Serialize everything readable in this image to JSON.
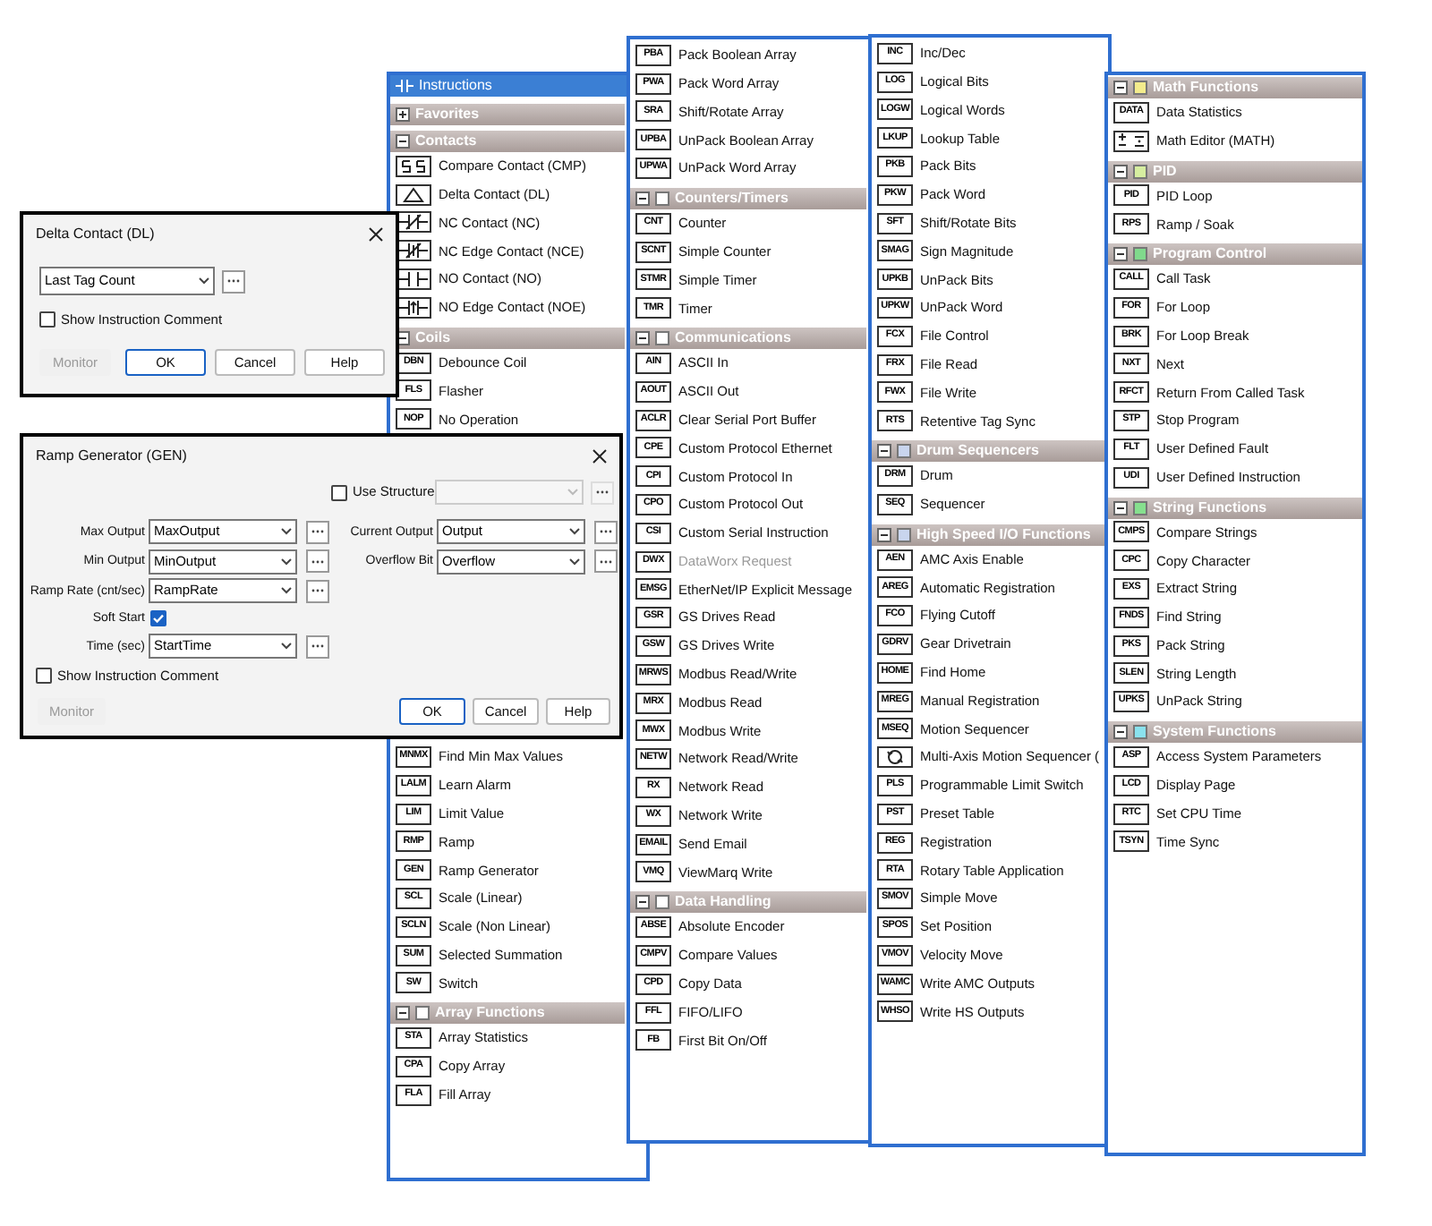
{
  "panels": [
    {
      "title": "Instructions",
      "sections": [
        {
          "header": "Favorites",
          "expanded": false
        },
        {
          "header": "Contacts",
          "expanded": true,
          "items": [
            {
              "kind": "compare",
              "label": "Compare Contact  (CMP)"
            },
            {
              "kind": "delta",
              "label": "Delta Contact  (DL)"
            },
            {
              "kind": "nc",
              "label": "NC Contact  (NC)"
            },
            {
              "kind": "nce",
              "label": "NC Edge Contact  (NCE)"
            },
            {
              "kind": "no",
              "label": "NO Contact  (NO)"
            },
            {
              "kind": "noe",
              "label": "NO Edge Contact  (NOE)"
            }
          ]
        },
        {
          "header": "Coils",
          "expanded": true,
          "items": [
            {
              "kind": "code",
              "code": "DBN",
              "label": "Debounce Coil"
            },
            {
              "kind": "code",
              "code": "FLS",
              "label": "Flasher"
            },
            {
              "kind": "code",
              "code": "NOP",
              "label": "No Operation"
            }
          ]
        },
        {
          "items": [
            {
              "kind": "code",
              "code": "MNMX",
              "label": "Find Min Max Values"
            },
            {
              "kind": "code",
              "code": "LALM",
              "label": "Learn Alarm"
            },
            {
              "kind": "code",
              "code": "LIM",
              "label": "Limit Value"
            },
            {
              "kind": "code",
              "code": "RMP",
              "label": "Ramp"
            },
            {
              "kind": "code",
              "code": "GEN",
              "label": "Ramp Generator"
            },
            {
              "kind": "code",
              "code": "SCL",
              "label": "Scale (Linear)"
            },
            {
              "kind": "code",
              "code": "SCLN",
              "label": "Scale (Non Linear)"
            },
            {
              "kind": "code",
              "code": "SUM",
              "label": "Selected Summation"
            },
            {
              "kind": "code",
              "code": "SW",
              "label": "Switch"
            }
          ]
        },
        {
          "header": "Array Functions",
          "expanded": true,
          "color": "#ffffff",
          "items": [
            {
              "kind": "code",
              "code": "STA",
              "label": "Array Statistics"
            },
            {
              "kind": "code",
              "code": "CPA",
              "label": "Copy Array"
            },
            {
              "kind": "code",
              "code": "FLA",
              "label": "Fill Array"
            }
          ]
        }
      ]
    },
    {
      "sections": [
        {
          "items": [
            {
              "kind": "code",
              "code": "PBA",
              "label": "Pack Boolean Array"
            },
            {
              "kind": "code",
              "code": "PWA",
              "label": "Pack Word Array"
            },
            {
              "kind": "code",
              "code": "SRA",
              "label": "Shift/Rotate Array"
            },
            {
              "kind": "code",
              "code": "UPBA",
              "label": "UnPack Boolean Array"
            },
            {
              "kind": "code",
              "code": "UPWA",
              "label": "UnPack Word Array"
            }
          ]
        },
        {
          "header": "Counters/Timers",
          "expanded": true,
          "color": "#ffffff",
          "items": [
            {
              "kind": "code",
              "code": "CNT",
              "label": "Counter"
            },
            {
              "kind": "code",
              "code": "SCNT",
              "label": "Simple Counter"
            },
            {
              "kind": "code",
              "code": "STMR",
              "label": "Simple Timer"
            },
            {
              "kind": "code",
              "code": "TMR",
              "label": "Timer"
            }
          ]
        },
        {
          "header": "Communications",
          "expanded": true,
          "color": "#ffffff",
          "items": [
            {
              "kind": "code",
              "code": "AIN",
              "label": "ASCII In",
              "disabled": false
            },
            {
              "kind": "code",
              "code": "AOUT",
              "label": "ASCII Out",
              "disabled": false
            },
            {
              "kind": "code",
              "code": "ACLR",
              "label": "Clear Serial Port Buffer",
              "disabled": false
            },
            {
              "kind": "code",
              "code": "CPE",
              "label": "Custom Protocol Ethernet",
              "disabled": false
            },
            {
              "kind": "code",
              "code": "CPI",
              "label": "Custom Protocol In",
              "disabled": false
            },
            {
              "kind": "code",
              "code": "CPO",
              "label": "Custom Protocol Out",
              "disabled": false
            },
            {
              "kind": "code",
              "code": "CSI",
              "label": "Custom Serial Instruction",
              "disabled": false
            },
            {
              "kind": "code",
              "code": "DWX",
              "label": "DataWorx Request",
              "disabled": true
            },
            {
              "kind": "code",
              "code": "EMSG",
              "label": "EtherNet/IP Explicit Message",
              "disabled": false
            },
            {
              "kind": "code",
              "code": "GSR",
              "label": "GS Drives Read",
              "disabled": false
            },
            {
              "kind": "code",
              "code": "GSW",
              "label": "GS Drives Write",
              "disabled": false
            },
            {
              "kind": "code",
              "code": "MRWS",
              "label": "Modbus Read/Write",
              "disabled": false
            },
            {
              "kind": "code",
              "code": "MRX",
              "label": "Modbus Read",
              "disabled": false
            },
            {
              "kind": "code",
              "code": "MWX",
              "label": "Modbus Write",
              "disabled": false
            },
            {
              "kind": "code",
              "code": "NETW",
              "label": "Network Read/Write",
              "disabled": false
            },
            {
              "kind": "code",
              "code": "RX",
              "label": "Network Read",
              "disabled": false
            },
            {
              "kind": "code",
              "code": "WX",
              "label": "Network Write",
              "disabled": false
            },
            {
              "kind": "code",
              "code": "EMAIL",
              "label": "Send Email",
              "disabled": false
            },
            {
              "kind": "code",
              "code": "VMQ",
              "label": "ViewMarq Write",
              "disabled": false
            }
          ]
        },
        {
          "header": "Data Handling",
          "expanded": true,
          "color": "#ffffff",
          "items": [
            {
              "kind": "code",
              "code": "ABSE",
              "label": "Absolute Encoder"
            },
            {
              "kind": "code",
              "code": "CMPV",
              "label": "Compare Values"
            },
            {
              "kind": "code",
              "code": "CPD",
              "label": "Copy Data"
            },
            {
              "kind": "code",
              "code": "FFL",
              "label": "FIFO/LIFO"
            },
            {
              "kind": "code",
              "code": "FB",
              "label": "First Bit On/Off"
            }
          ]
        }
      ]
    },
    {
      "sections": [
        {
          "items": [
            {
              "kind": "code",
              "code": "INC",
              "label": "Inc/Dec"
            },
            {
              "kind": "code",
              "code": "LOG",
              "label": "Logical Bits"
            },
            {
              "kind": "code",
              "code": "LOGW",
              "label": "Logical Words"
            },
            {
              "kind": "code",
              "code": "LKUP",
              "label": "Lookup Table"
            },
            {
              "kind": "code",
              "code": "PKB",
              "label": "Pack Bits"
            },
            {
              "kind": "code",
              "code": "PKW",
              "label": "Pack Word"
            },
            {
              "kind": "code",
              "code": "SFT",
              "label": "Shift/Rotate Bits"
            },
            {
              "kind": "code",
              "code": "SMAG",
              "label": "Sign Magnitude"
            },
            {
              "kind": "code",
              "code": "UPKB",
              "label": "UnPack Bits"
            },
            {
              "kind": "code",
              "code": "UPKW",
              "label": "UnPack Word"
            },
            {
              "kind": "code",
              "code": "FCX",
              "label": "File Control"
            },
            {
              "kind": "code",
              "code": "FRX",
              "label": "File Read"
            },
            {
              "kind": "code",
              "code": "FWX",
              "label": "File Write"
            },
            {
              "kind": "code",
              "code": "RTS",
              "label": "Retentive Tag Sync"
            }
          ]
        },
        {
          "header": "Drum Sequencers",
          "expanded": true,
          "color": "#c9d5ee",
          "items": [
            {
              "kind": "code",
              "code": "DRM",
              "label": "Drum"
            },
            {
              "kind": "code",
              "code": "SEQ",
              "label": "Sequencer"
            }
          ]
        },
        {
          "header": "High Speed I/O Functions",
          "expanded": true,
          "color": "#c9d5ee",
          "items": [
            {
              "kind": "code",
              "code": "AEN",
              "label": "AMC Axis Enable"
            },
            {
              "kind": "code",
              "code": "AREG",
              "label": "Automatic Registration"
            },
            {
              "kind": "code",
              "code": "FCO",
              "label": "Flying Cutoff"
            },
            {
              "kind": "code",
              "code": "GDRV",
              "label": "Gear Drivetrain"
            },
            {
              "kind": "code",
              "code": "HOME",
              "label": "Find Home"
            },
            {
              "kind": "code",
              "code": "MREG",
              "label": "Manual Registration"
            },
            {
              "kind": "code",
              "code": "MSEQ",
              "label": "Motion Sequencer"
            },
            {
              "kind": "motion",
              "label": "Multi-Axis Motion Sequencer ("
            },
            {
              "kind": "code",
              "code": "PLS",
              "label": "Programmable Limit Switch"
            },
            {
              "kind": "code",
              "code": "PST",
              "label": "Preset Table"
            },
            {
              "kind": "code",
              "code": "REG",
              "label": "Registration"
            },
            {
              "kind": "code",
              "code": "RTA",
              "label": "Rotary Table Application"
            },
            {
              "kind": "code",
              "code": "SMOV",
              "label": "Simple Move"
            },
            {
              "kind": "code",
              "code": "SPOS",
              "label": "Set Position"
            },
            {
              "kind": "code",
              "code": "VMOV",
              "label": "Velocity Move"
            },
            {
              "kind": "code",
              "code": "WAMC",
              "label": "Write AMC Outputs"
            },
            {
              "kind": "code",
              "code": "WHSO",
              "label": "Write HS Outputs"
            }
          ]
        }
      ]
    },
    {
      "sections": [
        {
          "header": "Math Functions",
          "expanded": true,
          "color": "#f3ec8c",
          "items": [
            {
              "kind": "code",
              "code": "DATA",
              "label": "Data Statistics"
            },
            {
              "kind": "math",
              "label": "Math Editor  (MATH)"
            }
          ]
        },
        {
          "header": "PID",
          "expanded": true,
          "color": "#d6eea0",
          "items": [
            {
              "kind": "code",
              "code": "PID",
              "label": "PID Loop"
            },
            {
              "kind": "code",
              "code": "RPS",
              "label": "Ramp / Soak"
            }
          ]
        },
        {
          "header": "Program Control",
          "expanded": true,
          "color": "#80d98c",
          "items": [
            {
              "kind": "code",
              "code": "CALL",
              "label": "Call Task"
            },
            {
              "kind": "code",
              "code": "FOR",
              "label": "For Loop"
            },
            {
              "kind": "code",
              "code": "BRK",
              "label": "For Loop Break"
            },
            {
              "kind": "code",
              "code": "NXT",
              "label": "Next"
            },
            {
              "kind": "code",
              "code": "RFCT",
              "label": "Return From Called Task"
            },
            {
              "kind": "code",
              "code": "STP",
              "label": "Stop Program"
            },
            {
              "kind": "code",
              "code": "FLT",
              "label": "User Defined Fault"
            },
            {
              "kind": "code",
              "code": "UDI",
              "label": "User Defined Instruction"
            }
          ]
        },
        {
          "header": "String Functions",
          "expanded": true,
          "color": "#86e08e",
          "items": [
            {
              "kind": "code",
              "code": "CMPS",
              "label": "Compare Strings"
            },
            {
              "kind": "code",
              "code": "CPC",
              "label": "Copy Character"
            },
            {
              "kind": "code",
              "code": "EXS",
              "label": "Extract String"
            },
            {
              "kind": "code",
              "code": "FNDS",
              "label": "Find String"
            },
            {
              "kind": "code",
              "code": "PKS",
              "label": "Pack String"
            },
            {
              "kind": "code",
              "code": "SLEN",
              "label": "String Length"
            },
            {
              "kind": "code",
              "code": "UPKS",
              "label": "UnPack String"
            }
          ]
        },
        {
          "header": "System Functions",
          "expanded": true,
          "color": "#8ae2ee",
          "items": [
            {
              "kind": "code",
              "code": "ASP",
              "label": "Access System Parameters"
            },
            {
              "kind": "code",
              "code": "LCD",
              "label": "Display Page"
            },
            {
              "kind": "code",
              "code": "RTC",
              "label": "Set CPU Time"
            },
            {
              "kind": "code",
              "code": "TSYN",
              "label": "Time Sync"
            }
          ]
        }
      ]
    }
  ],
  "delta_dialog": {
    "title": "Delta Contact (DL)",
    "value": "Last Tag Count",
    "show_comment": {
      "label": "Show Instruction Comment",
      "checked": false
    },
    "buttons": [
      {
        "label": "Monitor",
        "disabled": true,
        "default": false
      },
      {
        "label": "OK",
        "disabled": false,
        "default": true
      },
      {
        "label": "Cancel",
        "disabled": false,
        "default": false
      },
      {
        "label": "Help",
        "disabled": false,
        "default": false
      }
    ]
  },
  "ramp_dialog": {
    "title": "Ramp Generator (GEN)",
    "use_structure": {
      "label": "Use Structure",
      "checked": false
    },
    "left_rows": [
      {
        "kind": "field",
        "label": "Max Output",
        "value": "MaxOutput"
      },
      {
        "kind": "field",
        "label": "Min Output",
        "value": "MinOutput"
      },
      {
        "kind": "field",
        "label": "Ramp Rate (cnt/sec)",
        "value": "RampRate"
      },
      {
        "kind": "checkbox",
        "label": "Soft Start",
        "checked": true
      },
      {
        "kind": "field",
        "label": "Time (sec)",
        "value": "StartTime"
      }
    ],
    "right_rows": [
      {
        "kind": "field",
        "label": "Current Output",
        "value": "Output"
      },
      {
        "kind": "field",
        "label": "Overflow Bit",
        "value": "Overflow"
      }
    ],
    "show_comment": {
      "label": "Show Instruction Comment",
      "checked": false
    },
    "buttons": [
      {
        "label": "Monitor",
        "disabled": true,
        "default": false
      },
      {
        "label": "OK",
        "disabled": false,
        "default": true
      },
      {
        "label": "Cancel",
        "disabled": false,
        "default": false
      },
      {
        "label": "Help",
        "disabled": false,
        "default": false
      }
    ]
  }
}
